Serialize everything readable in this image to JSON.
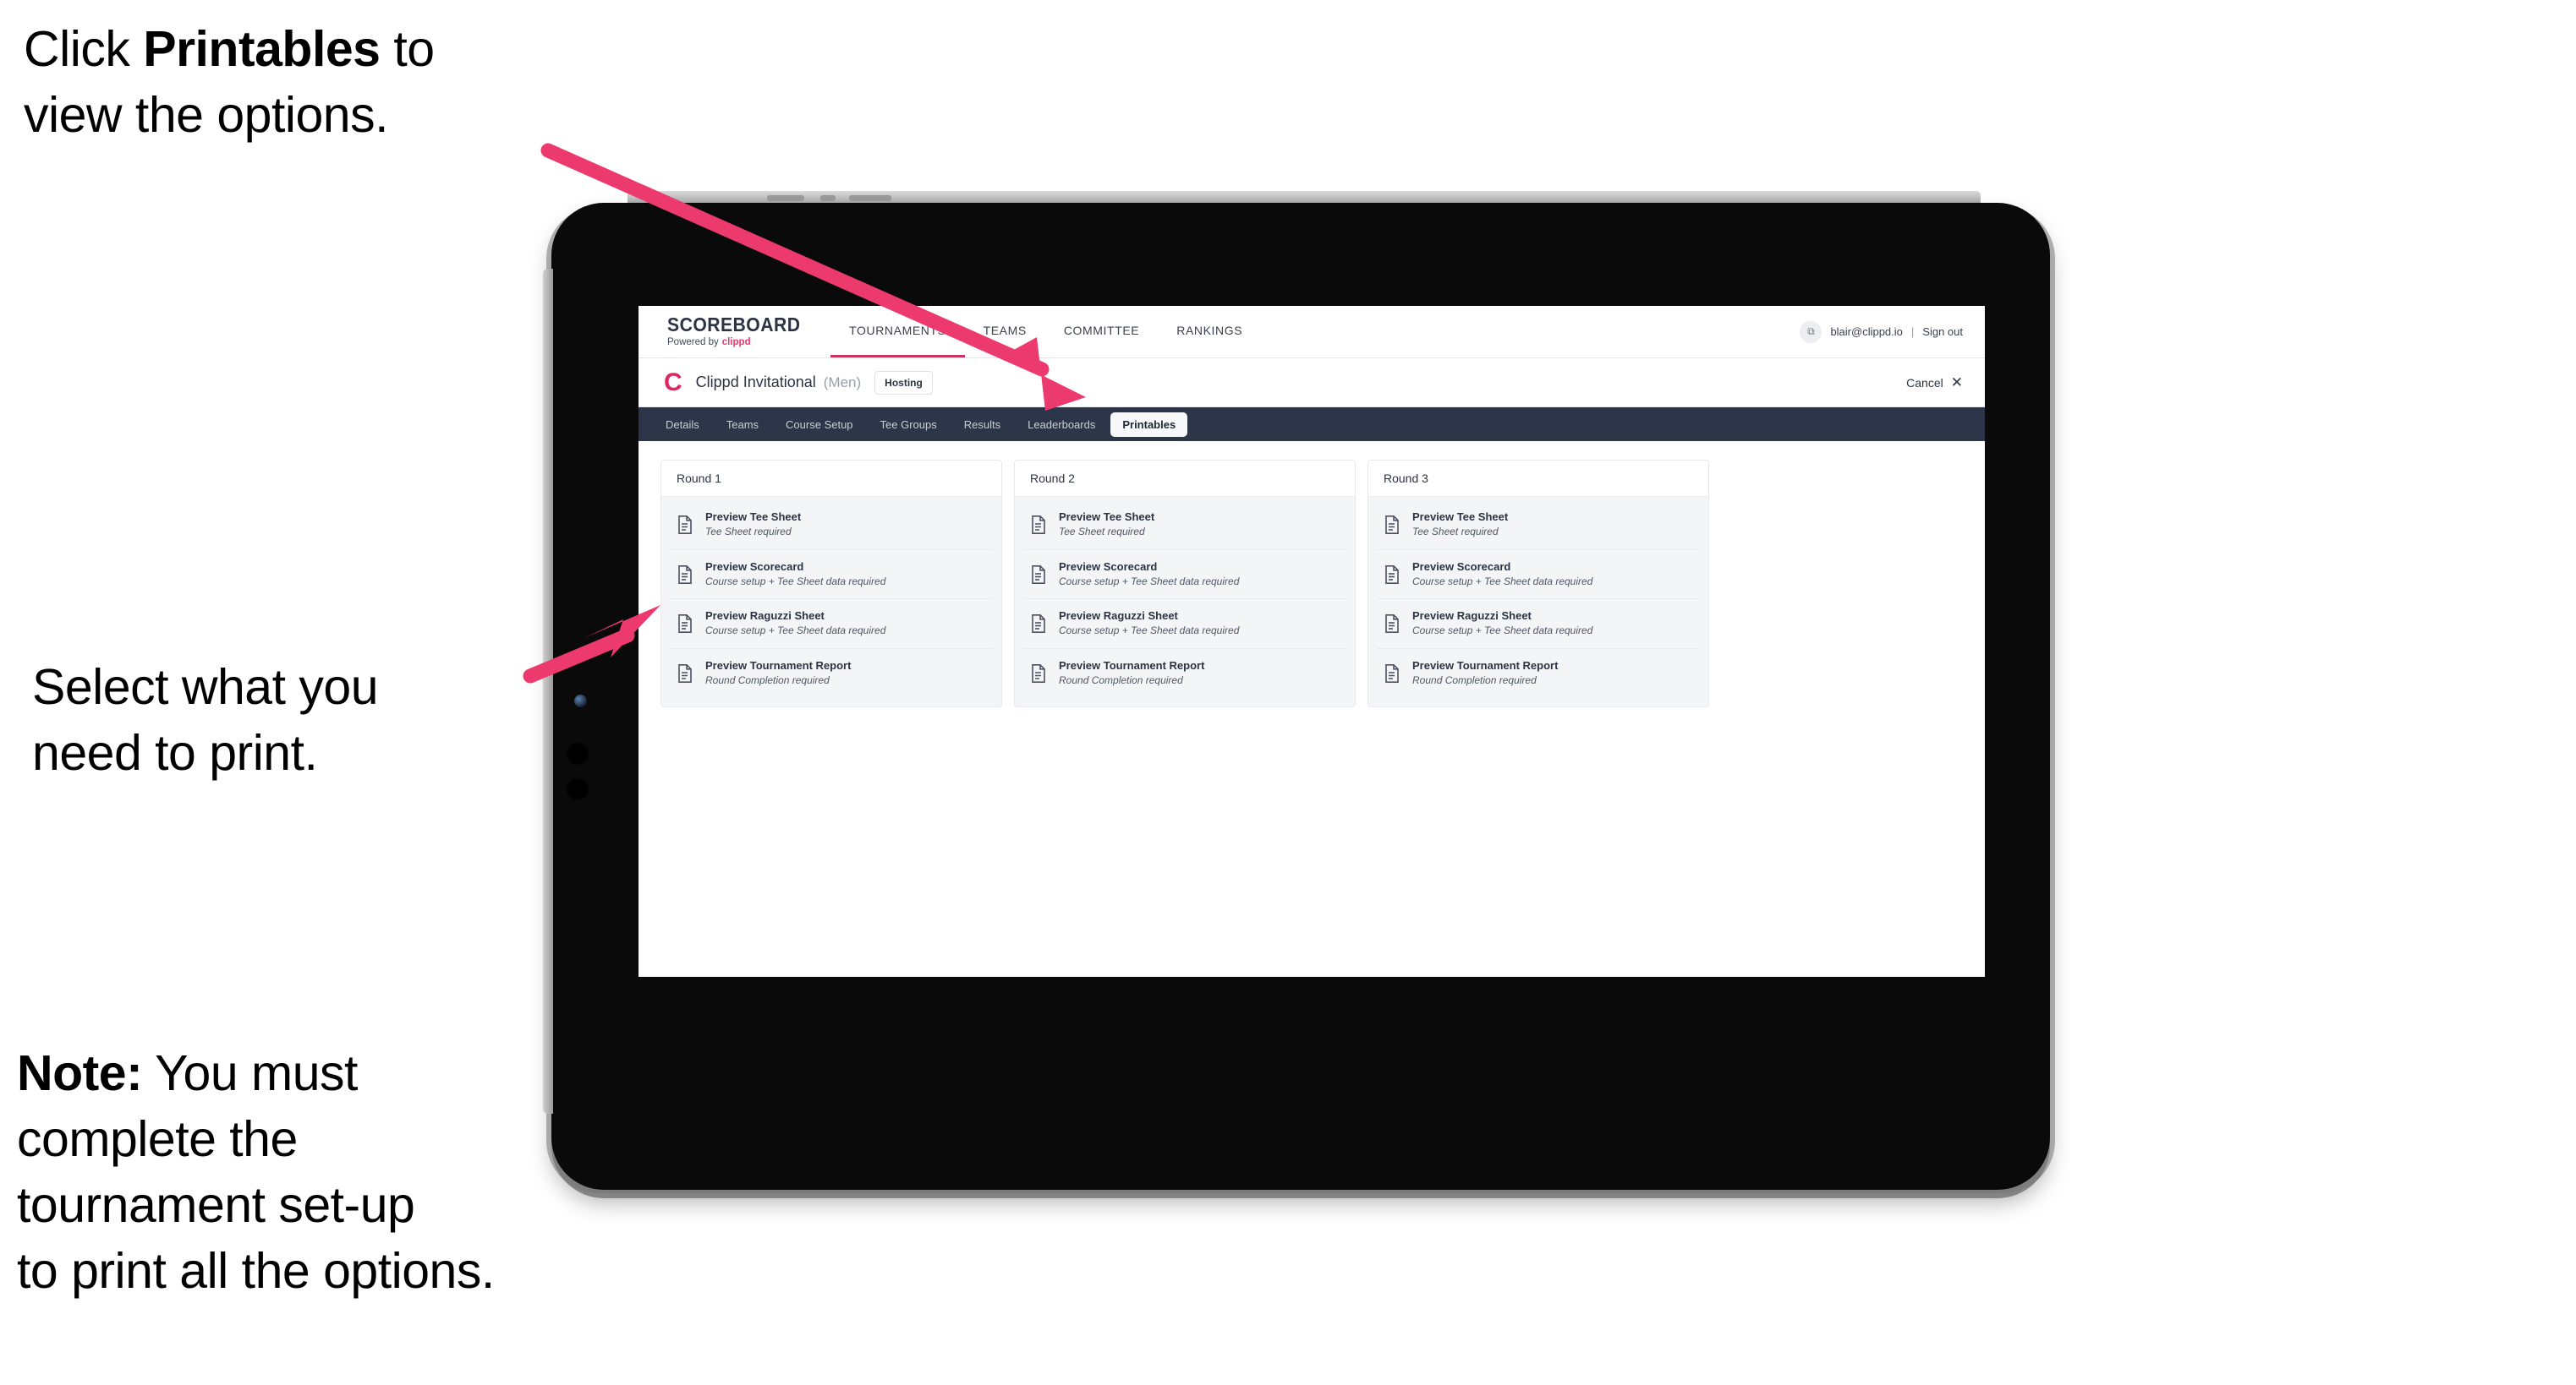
{
  "annotations": [
    {
      "id": "annot-1",
      "prefix": "Click ",
      "bold": "Printables",
      "suffix": " to\nview the options."
    },
    {
      "id": "annot-2",
      "text": "Select what you\n need to print."
    },
    {
      "id": "annot-3",
      "bold": "Note:",
      "suffix": " You must\ncomplete the\ntournament set-up\nto print all the options."
    }
  ],
  "colors": {
    "arrow_pink": "#ec3a6e",
    "brand_pink": "#e8376b",
    "tab_active_underline": "#c5355f",
    "dark_navy": "#2c3648"
  },
  "app": {
    "brand": {
      "title": "SCOREBOARD",
      "powered_prefix": "Powered by",
      "powered_brand": "clippd"
    },
    "topnav": [
      {
        "label": "TOURNAMENTS",
        "active": true
      },
      {
        "label": "TEAMS",
        "active": false
      },
      {
        "label": "COMMITTEE",
        "active": false
      },
      {
        "label": "RANKINGS",
        "active": false
      }
    ],
    "account": {
      "avatar_glyph": "⧉",
      "email": "blair@clippd.io",
      "separator": "|",
      "signout": "Sign out"
    },
    "tournament": {
      "logo_letter": "C",
      "name": "Clippd Invitational",
      "gender": "(Men)",
      "badge": "Hosting",
      "cancel_label": "Cancel",
      "cancel_icon": "✕"
    },
    "tabs": [
      {
        "label": "Details",
        "active": false
      },
      {
        "label": "Teams",
        "active": false
      },
      {
        "label": "Course Setup",
        "active": false
      },
      {
        "label": "Tee Groups",
        "active": false
      },
      {
        "label": "Results",
        "active": false
      },
      {
        "label": "Leaderboards",
        "active": false
      },
      {
        "label": "Printables",
        "active": true
      }
    ],
    "rounds": [
      {
        "title": "Round 1",
        "items": [
          {
            "title": "Preview Tee Sheet",
            "sub": "Tee Sheet required"
          },
          {
            "title": "Preview Scorecard",
            "sub": "Course setup + Tee Sheet data required"
          },
          {
            "title": "Preview Raguzzi Sheet",
            "sub": "Course setup + Tee Sheet data required"
          },
          {
            "title": "Preview Tournament Report",
            "sub": "Round Completion required"
          }
        ]
      },
      {
        "title": "Round 2",
        "items": [
          {
            "title": "Preview Tee Sheet",
            "sub": "Tee Sheet required"
          },
          {
            "title": "Preview Scorecard",
            "sub": "Course setup + Tee Sheet data required"
          },
          {
            "title": "Preview Raguzzi Sheet",
            "sub": "Course setup + Tee Sheet data required"
          },
          {
            "title": "Preview Tournament Report",
            "sub": "Round Completion required"
          }
        ]
      },
      {
        "title": "Round 3",
        "items": [
          {
            "title": "Preview Tee Sheet",
            "sub": "Tee Sheet required"
          },
          {
            "title": "Preview Scorecard",
            "sub": "Course setup + Tee Sheet data required"
          },
          {
            "title": "Preview Raguzzi Sheet",
            "sub": "Course setup + Tee Sheet data required"
          },
          {
            "title": "Preview Tournament Report",
            "sub": "Round Completion required"
          }
        ]
      }
    ]
  }
}
